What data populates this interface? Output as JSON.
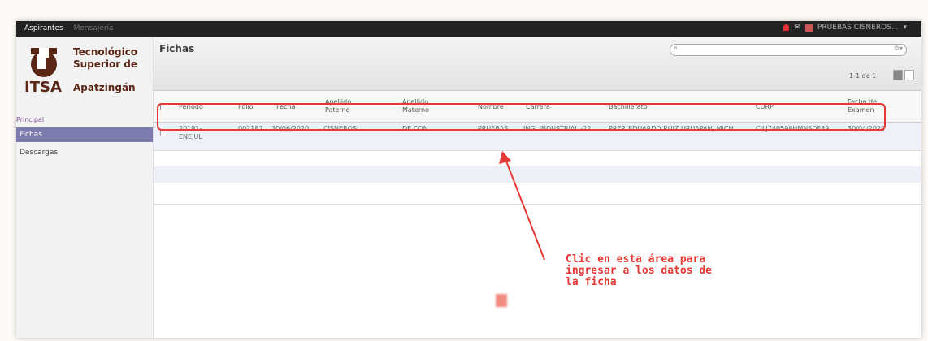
{
  "topbar": {
    "nav": [
      "Aspirantes",
      "Mensajería"
    ],
    "user": "PRUEBAS CISNEROS..."
  },
  "logo": {
    "line1": "Tecnológico",
    "line2": "Superior de",
    "itsa": "ITSA",
    "apat": "Apatzingán"
  },
  "sidebar": {
    "section": "Principal",
    "items": [
      "Fichas",
      "Descargas"
    ]
  },
  "header": {
    "title": "Fichas",
    "pager": "1-1 de 1"
  },
  "table": {
    "columns": [
      "Periodo",
      "Folio",
      "Fecha",
      "Apellido Paterno",
      "Apellido Materno",
      "Nombre",
      "Carrera",
      "Bachillerato",
      "CURP",
      "Fecha de Examen"
    ],
    "row": [
      "20191-ENEJUL",
      "002187",
      "30/06/2020",
      "CISNEROSL",
      "DE CON",
      "PRUEBAS",
      "ING. INDUSTRIAL -22",
      "PREP. EDUARDO RUIZ URUAPAN, MICH",
      "CILJ740598HMNSDF89",
      "30/04/2020"
    ]
  },
  "annotation": "Clic en esta área para\ningresar a los datos de\nla ficha",
  "colors": {
    "accent": "#e53935",
    "active": "#7c7bad"
  }
}
